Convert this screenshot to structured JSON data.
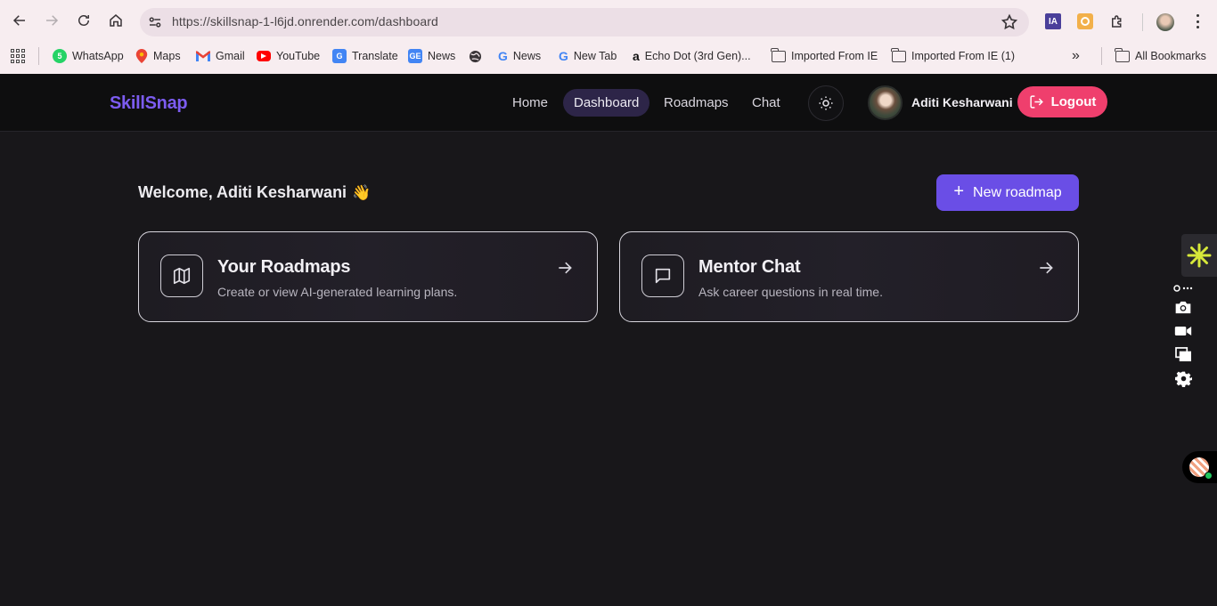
{
  "browser": {
    "url": "https://skillsnap-1-l6jd.onrender.com/dashboard",
    "bookmarks": [
      {
        "label": "WhatsApp"
      },
      {
        "label": "Maps"
      },
      {
        "label": "Gmail"
      },
      {
        "label": "YouTube"
      },
      {
        "label": "Translate"
      },
      {
        "label": "News"
      },
      {
        "label": ""
      },
      {
        "label": "News"
      },
      {
        "label": "New Tab"
      },
      {
        "label": "Echo Dot (3rd Gen)..."
      },
      {
        "label": "Imported From IE"
      },
      {
        "label": "Imported From IE (1)"
      }
    ],
    "all_bookmarks": "All Bookmarks",
    "ext_ia": "IA",
    "whatsapp_badge": "5"
  },
  "app": {
    "brand": "SkillSnap",
    "nav": {
      "home": "Home",
      "dashboard": "Dashboard",
      "roadmaps": "Roadmaps",
      "chat": "Chat"
    },
    "user_name": "Aditi Kesharwani",
    "logout": "Logout",
    "welcome": "Welcome, Aditi Kesharwani",
    "wave": "👋",
    "new_roadmap": "New roadmap",
    "new_roadmap_plus": "+",
    "cards": [
      {
        "title": "Your Roadmaps",
        "desc": "Create or view AI-generated learning plans."
      },
      {
        "title": "Mentor Chat",
        "desc": "Ask career questions in real time."
      }
    ]
  },
  "colors": {
    "accent": "#6a4ee6",
    "brand": "#7c5cf0",
    "logout": "#ef3f6d",
    "background": "#18171a"
  }
}
